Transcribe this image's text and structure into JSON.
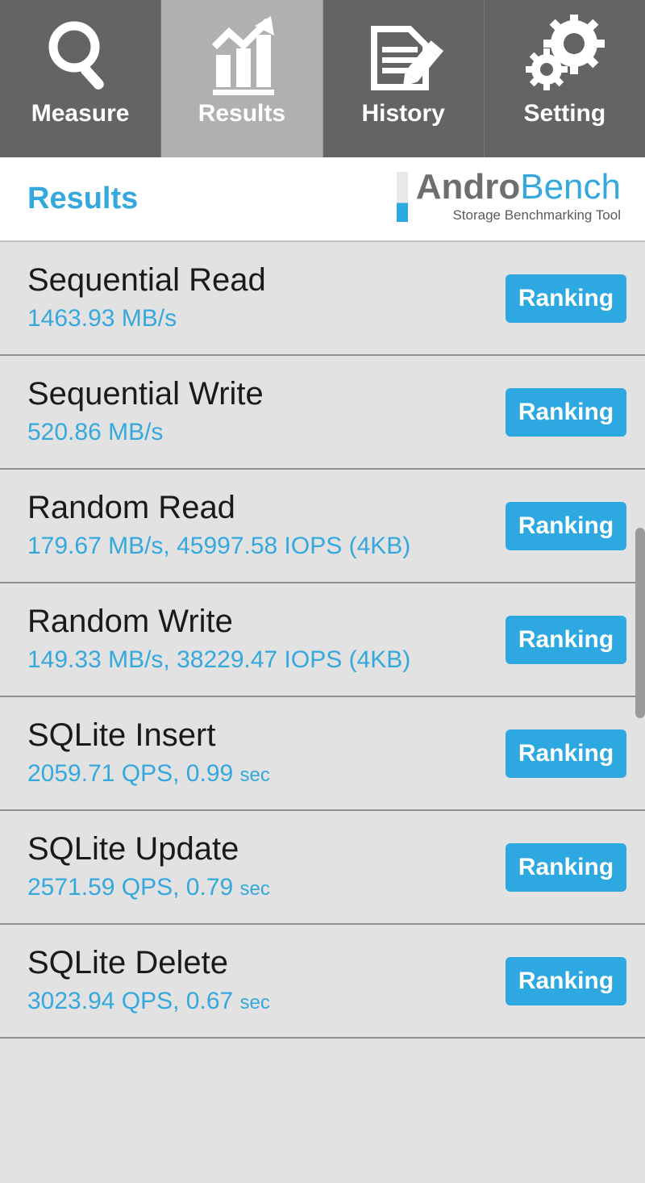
{
  "tabs": [
    {
      "label": "Measure",
      "icon": "magnifier-icon",
      "active": false
    },
    {
      "label": "Results",
      "icon": "bar-chart-arrow-icon",
      "active": true
    },
    {
      "label": "History",
      "icon": "document-pencil-icon",
      "active": false
    },
    {
      "label": "Setting",
      "icon": "gears-icon",
      "active": false
    }
  ],
  "header": {
    "title": "Results",
    "logo_primary": "Andro",
    "logo_secondary": "Bench",
    "logo_tagline": "Storage Benchmarking Tool"
  },
  "colors": {
    "accent_blue": "#35a8dd",
    "button_blue": "#2ea8e0",
    "tab_inactive": "#646464",
    "tab_active": "#b0b0b0",
    "list_background": "#e2e2e2",
    "logo_gray": "#6e6e6e"
  },
  "results": [
    {
      "name": "Sequential Read",
      "value": "1463.93 MB/s",
      "value_suffix": "",
      "button": "Ranking"
    },
    {
      "name": "Sequential Write",
      "value": "520.86 MB/s",
      "value_suffix": "",
      "button": "Ranking"
    },
    {
      "name": "Random Read",
      "value": "179.67 MB/s, 45997.58 IOPS (4KB)",
      "value_suffix": "",
      "button": "Ranking"
    },
    {
      "name": "Random Write",
      "value": "149.33 MB/s, 38229.47 IOPS (4KB)",
      "value_suffix": "",
      "button": "Ranking"
    },
    {
      "name": "SQLite Insert",
      "value": "2059.71 QPS, 0.99 ",
      "value_suffix": "sec",
      "button": "Ranking"
    },
    {
      "name": "SQLite Update",
      "value": "2571.59 QPS, 0.79 ",
      "value_suffix": "sec",
      "button": "Ranking"
    },
    {
      "name": "SQLite Delete",
      "value": "3023.94 QPS, 0.67 ",
      "value_suffix": "sec",
      "button": "Ranking"
    }
  ]
}
